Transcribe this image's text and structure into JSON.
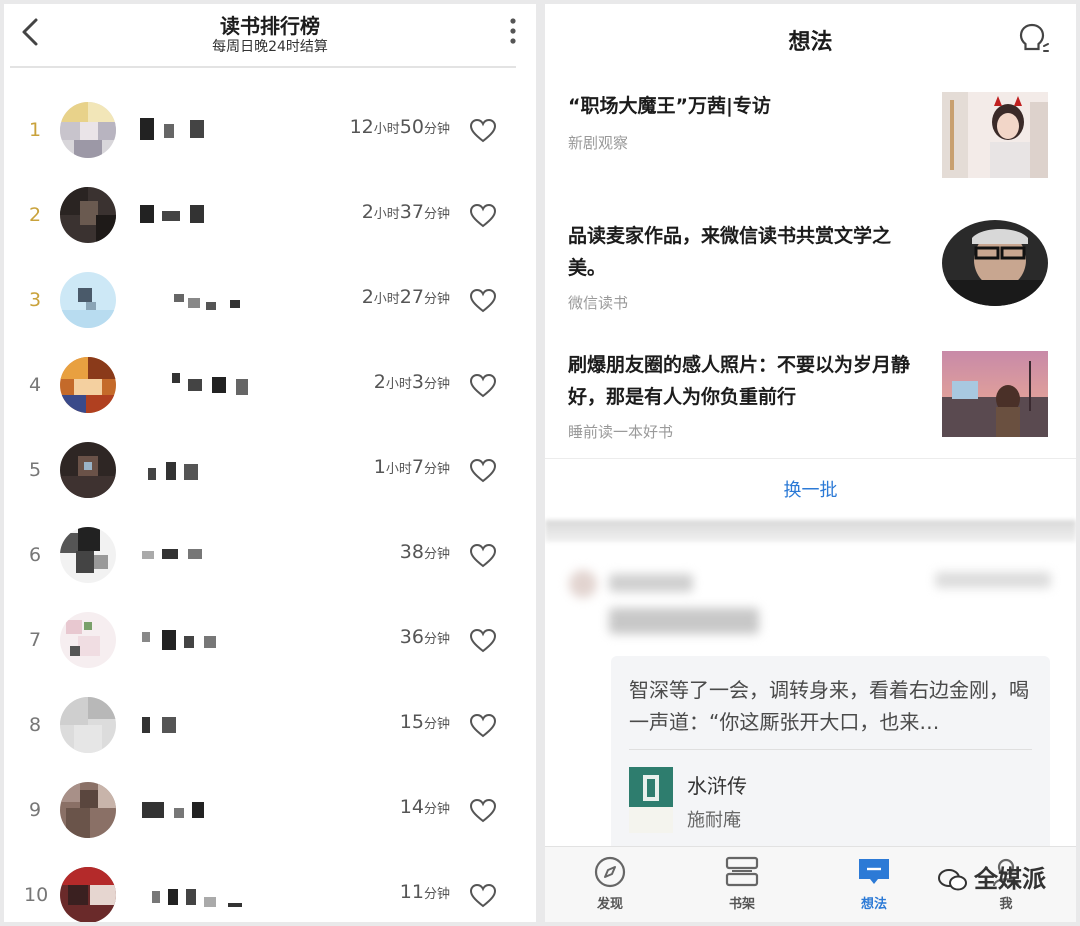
{
  "left": {
    "title": "读书排行榜",
    "subtitle": "每周日晚24时结算",
    "rows": [
      {
        "rank": "1",
        "h": "12",
        "hu": "小时",
        "m": "50",
        "mu": "分钟",
        "top": true
      },
      {
        "rank": "2",
        "h": "2",
        "hu": "小时",
        "m": "37",
        "mu": "分钟",
        "top": true
      },
      {
        "rank": "3",
        "h": "2",
        "hu": "小时",
        "m": "27",
        "mu": "分钟",
        "top": true
      },
      {
        "rank": "4",
        "h": "2",
        "hu": "小时",
        "m": "3",
        "mu": "分钟",
        "top": false
      },
      {
        "rank": "5",
        "h": "1",
        "hu": "小时",
        "m": "7",
        "mu": "分钟",
        "top": false
      },
      {
        "rank": "6",
        "h": "",
        "hu": "",
        "m": "38",
        "mu": "分钟",
        "top": false
      },
      {
        "rank": "7",
        "h": "",
        "hu": "",
        "m": "36",
        "mu": "分钟",
        "top": false
      },
      {
        "rank": "8",
        "h": "",
        "hu": "",
        "m": "15",
        "mu": "分钟",
        "top": false
      },
      {
        "rank": "9",
        "h": "",
        "hu": "",
        "m": "14",
        "mu": "分钟",
        "top": false
      },
      {
        "rank": "10",
        "h": "",
        "hu": "",
        "m": "11",
        "mu": "分钟",
        "top": false
      }
    ]
  },
  "right": {
    "title": "想法",
    "articles": [
      {
        "title": "“职场大魔王”万茜|专访",
        "source": "新剧观察"
      },
      {
        "title": "品读麦家作品，来微信读书共赏文学之美。",
        "source": "微信读书"
      },
      {
        "title": "刷爆朋友圈的感人照片：不要以为岁月静好，那是有人为你负重前行",
        "source": "睡前读一本好书"
      }
    ],
    "swap_label": "换一批",
    "quote": {
      "text": "智深等了一会，调转身来，看着右边金刚，喝一声道：“你这厮张开大口，也来…",
      "book_title": "水浒传",
      "book_author": "施耐庵"
    },
    "tabs": [
      {
        "label": "发现",
        "icon": "compass-icon"
      },
      {
        "label": "书架",
        "icon": "bookshelf-icon"
      },
      {
        "label": "想法",
        "icon": "thoughts-icon"
      },
      {
        "label": "我",
        "icon": "profile-icon"
      }
    ],
    "active_tab": "想法",
    "watermark": "全媒派"
  },
  "colors": {
    "accent": "#2c7ad6",
    "gold_rank": "#c9a23b",
    "book_cover": "#2e7d6e"
  }
}
